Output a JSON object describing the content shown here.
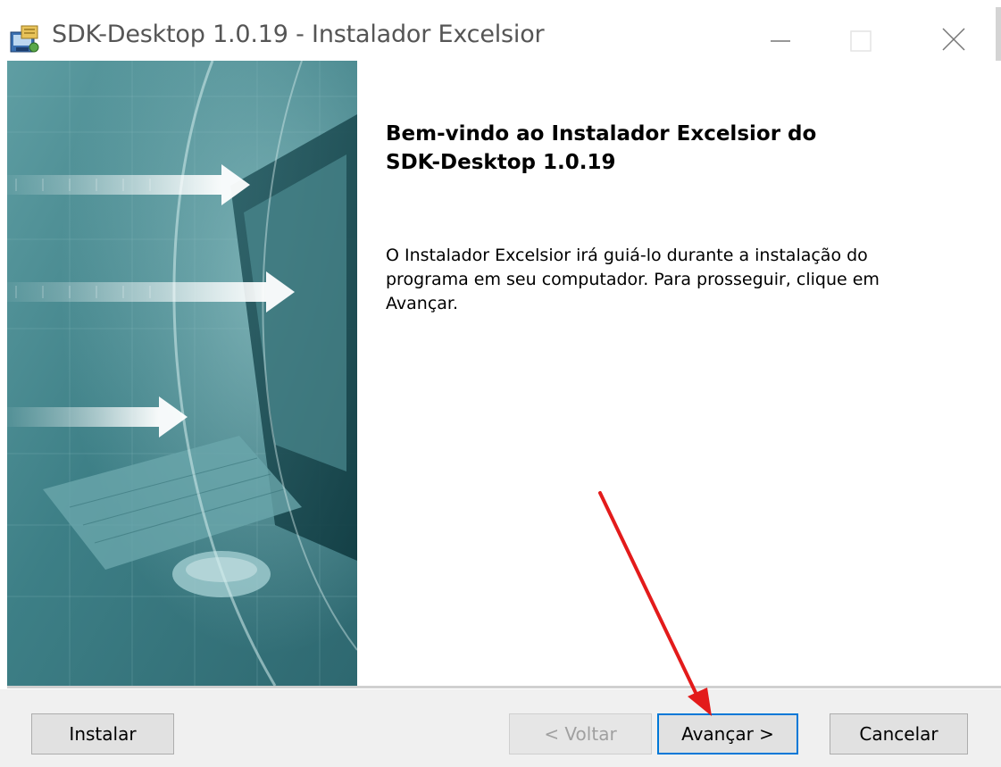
{
  "window": {
    "title": "SDK-Desktop 1.0.19 - Instalador Excelsior",
    "controls": [
      "minimize",
      "maximize",
      "close"
    ]
  },
  "welcome": {
    "heading_line1": "Bem-vindo ao Instalador Excelsior do",
    "heading_line2": "SDK-Desktop 1.0.19",
    "body_line1": "O Instalador Excelsior irá guiá-lo durante a instalação do",
    "body_line2": "programa em seu computador. Para prosseguir, clique em",
    "body_line3": "Avançar."
  },
  "buttons": {
    "install": "Instalar",
    "back": "< Voltar",
    "next": "Avançar >",
    "cancel": "Cancelar"
  },
  "states": {
    "back_enabled": false,
    "focused_button": "next"
  },
  "annotation": {
    "type": "arrow",
    "color": "#e31b1b",
    "points_to": "next-button"
  },
  "icons": {
    "app": "installer-icon",
    "minimize": "minimize-icon",
    "maximize": "maximize-icon",
    "close": "close-icon"
  },
  "colors": {
    "focus_border": "#0078d7",
    "footer_bg": "#f0f0f0",
    "side_panel": "#4f8f95"
  }
}
